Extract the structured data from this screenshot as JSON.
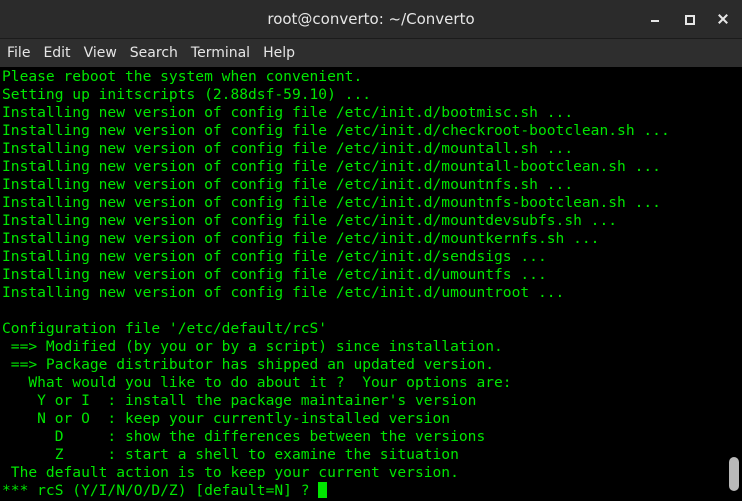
{
  "window": {
    "title": "root@converto: ~/Converto",
    "buttons": [
      "minimize-icon",
      "maximize-icon",
      "close-icon"
    ]
  },
  "menu": [
    "File",
    "Edit",
    "View",
    "Search",
    "Terminal",
    "Help"
  ],
  "colors": {
    "text": "#00e600",
    "background": "#000000",
    "titlebar": "#2b2b2b"
  },
  "terminal": {
    "lines": [
      "Please reboot the system when convenient.",
      "Setting up initscripts (2.88dsf-59.10) ...",
      "Installing new version of config file /etc/init.d/bootmisc.sh ...",
      "Installing new version of config file /etc/init.d/checkroot-bootclean.sh ...",
      "Installing new version of config file /etc/init.d/mountall.sh ...",
      "Installing new version of config file /etc/init.d/mountall-bootclean.sh ...",
      "Installing new version of config file /etc/init.d/mountnfs.sh ...",
      "Installing new version of config file /etc/init.d/mountnfs-bootclean.sh ...",
      "Installing new version of config file /etc/init.d/mountdevsubfs.sh ...",
      "Installing new version of config file /etc/init.d/mountkernfs.sh ...",
      "Installing new version of config file /etc/init.d/sendsigs ...",
      "Installing new version of config file /etc/init.d/umountfs ...",
      "Installing new version of config file /etc/init.d/umountroot ...",
      "",
      "Configuration file '/etc/default/rcS'",
      " ==> Modified (by you or by a script) since installation.",
      " ==> Package distributor has shipped an updated version.",
      "   What would you like to do about it ?  Your options are:",
      "    Y or I  : install the package maintainer's version",
      "    N or O  : keep your currently-installed version",
      "      D     : show the differences between the versions",
      "      Z     : start a shell to examine the situation",
      " The default action is to keep your current version."
    ],
    "prompt": "*** rcS (Y/I/N/O/D/Z) [default=N] ? "
  }
}
